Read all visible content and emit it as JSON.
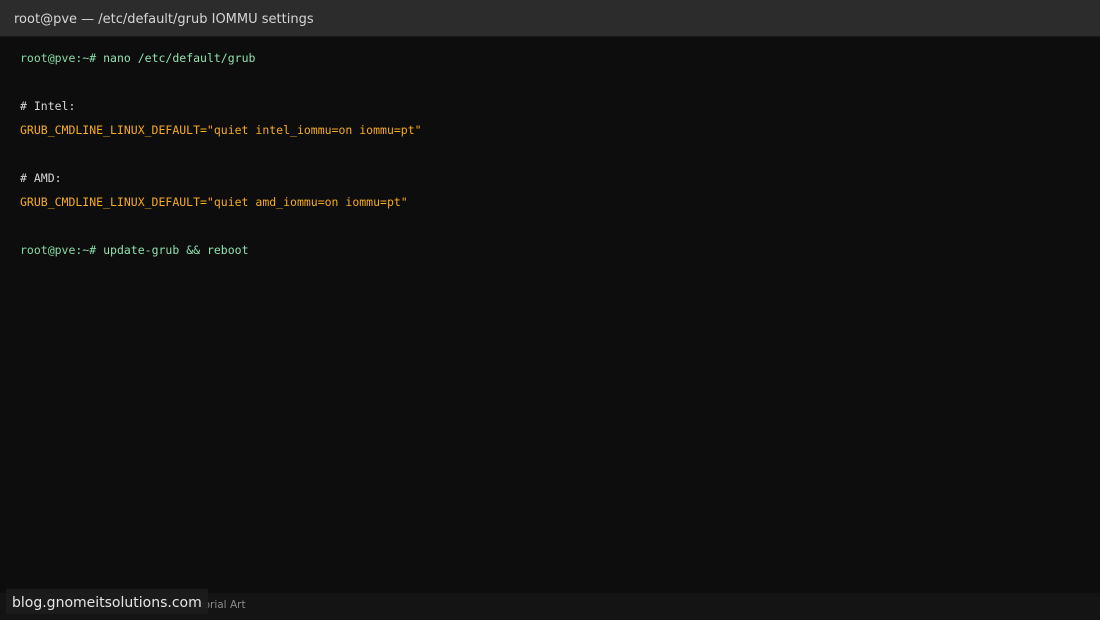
{
  "window": {
    "title": "root@pve — /etc/default/grub IOMMU settings"
  },
  "terminal": {
    "lines": [
      {
        "prompt": "root@pve:~#",
        "command": "nano /etc/default/grub"
      },
      {
        "text": "# Intel:"
      },
      {
        "text": "GRUB_CMDLINE_LINUX_DEFAULT=\"quiet intel_iommu=on iommu=pt\""
      },
      {
        "text": "# AMD:"
      },
      {
        "text": "GRUB_CMDLINE_LINUX_DEFAULT=\"quiet amd_iommu=on iommu=pt\""
      },
      {
        "prompt": "root@pve:~#",
        "command": "update-grub && reboot"
      }
    ]
  },
  "footer": {
    "credit": "Tutorial Art"
  },
  "watermark": {
    "text": "blog.gnomeitsolutions.com"
  },
  "colors": {
    "background": "#0d0d0d",
    "titlebar": "#2c2c2c",
    "prompt": "#86d9a4",
    "config": "#f5ac1f",
    "comment": "#d6d6d6"
  }
}
